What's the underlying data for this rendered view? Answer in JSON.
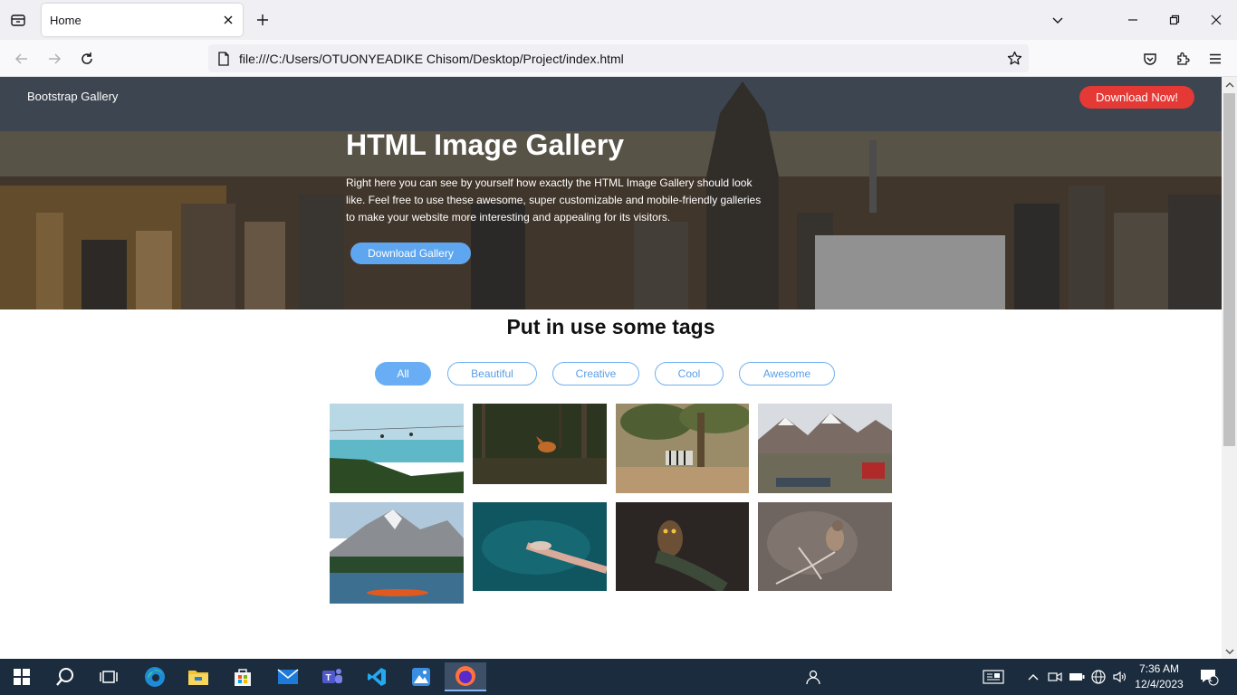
{
  "browser": {
    "tab_title": "Home",
    "url": "file:///C:/Users/OTUONYEADIKE Chisom/Desktop/Project/index.html"
  },
  "page": {
    "brand": "Bootstrap Gallery",
    "cta_top": "Download Now!",
    "hero_title": "HTML Image Gallery",
    "hero_description": "Right here you can see by yourself how exactly the HTML Image Gallery should look like. Feel free to use these awesome, super customizable and mobile-friendly galleries to make your website more interesting and appealing for its visitors.",
    "hero_button": "Download Gallery",
    "section_title": "Put in use some tags",
    "filters": [
      "All",
      "Beautiful",
      "Creative",
      "Cool",
      "Awesome"
    ],
    "active_filter": "All"
  },
  "taskbar": {
    "time": "7:36 AM",
    "date": "12/4/2023",
    "notification_count": "1"
  },
  "colors": {
    "accent_blue": "#69aef5",
    "cta_red": "#e53935",
    "taskbar": "#1b2c3e"
  }
}
